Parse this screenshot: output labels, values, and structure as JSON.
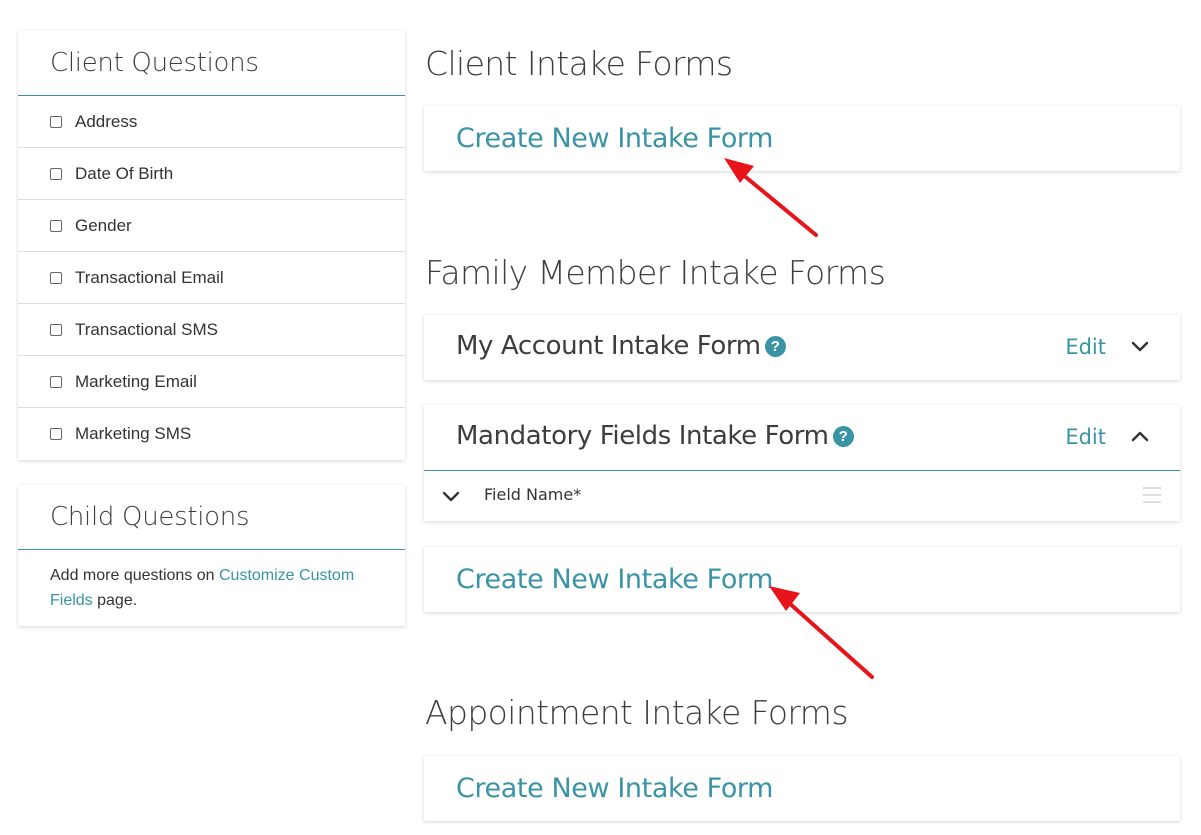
{
  "sidebar": {
    "client_questions": {
      "title": "Client Questions",
      "items": [
        {
          "label": "Address"
        },
        {
          "label": "Date Of Birth"
        },
        {
          "label": "Gender"
        },
        {
          "label": "Transactional Email"
        },
        {
          "label": "Transactional SMS"
        },
        {
          "label": "Marketing Email"
        },
        {
          "label": "Marketing SMS"
        }
      ]
    },
    "child_questions": {
      "title": "Child Questions",
      "text_before": "Add more questions on ",
      "link": "Customize Custom Fields",
      "text_after": " page."
    }
  },
  "client_intake": {
    "title": "Client Intake Forms",
    "create_label": "Create New Intake Form"
  },
  "family_intake": {
    "title": "Family Member Intake Forms",
    "forms": [
      {
        "title": "My Account Intake Form",
        "edit_label": "Edit",
        "expanded": false
      },
      {
        "title": "Mandatory Fields Intake Form",
        "edit_label": "Edit",
        "expanded": true,
        "fields": [
          {
            "name": "Field Name*"
          }
        ]
      }
    ],
    "create_label": "Create New Intake Form"
  },
  "appointment_intake": {
    "title": "Appointment Intake Forms",
    "create_label": "Create New Intake Form"
  },
  "help_glyph": "?",
  "colors": {
    "accent": "#3a94a6",
    "annotation_arrow": "#e8141a"
  }
}
